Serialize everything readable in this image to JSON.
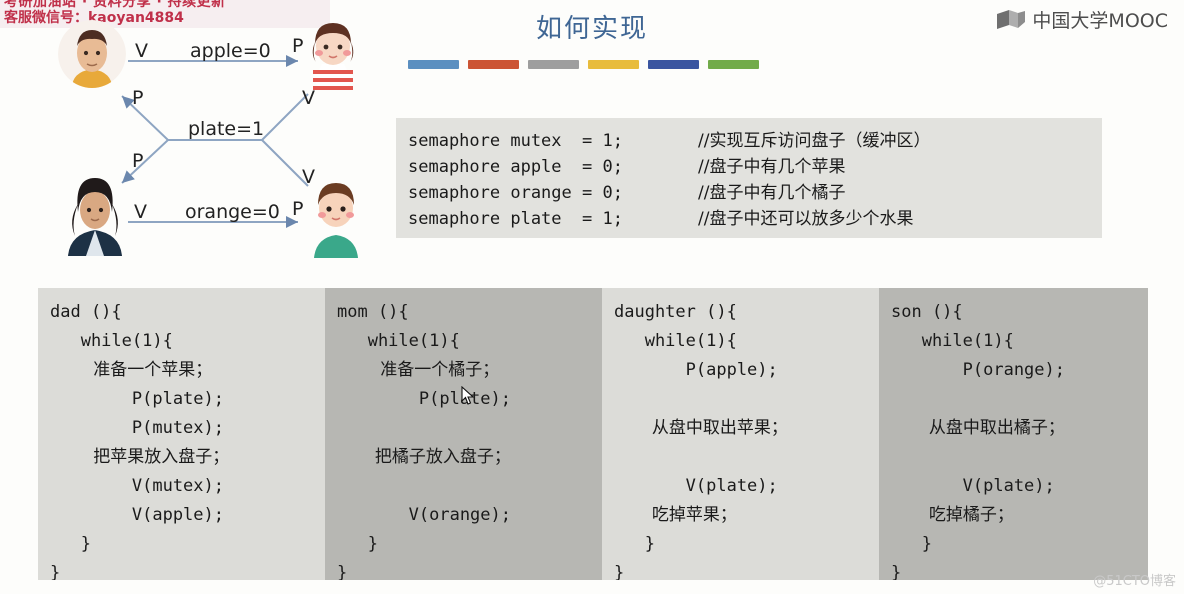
{
  "banner": {
    "line1": "考研加油站 · 资料分享 · 持续更新",
    "line2": "客服微信号：kaoyan4884"
  },
  "brand": {
    "logo_icon": "book-logo-icon",
    "name": "中国大学MOOC"
  },
  "slide": {
    "title": "如何实现",
    "accent_bars": [
      "#5b8fc0",
      "#cc5434",
      "#9e9e9e",
      "#e8bc3c",
      "#3a55a0",
      "#72ab4a"
    ]
  },
  "diagram": {
    "actors": [
      {
        "id": "dad",
        "name": "dad-avatar",
        "role": "父亲"
      },
      {
        "id": "daughter",
        "name": "daughter-avatar",
        "role": "女儿"
      },
      {
        "id": "mom",
        "name": "mom-avatar",
        "role": "母亲"
      },
      {
        "id": "son",
        "name": "son-avatar",
        "role": "儿子"
      }
    ],
    "edges": [
      {
        "id": "apple",
        "label": "apple=0",
        "from_op": "V",
        "to_op": "P"
      },
      {
        "id": "plate",
        "label": "plate=1",
        "from_op": "P",
        "to_op": "V"
      },
      {
        "id": "orange",
        "label": "orange=0",
        "from_op": "V",
        "to_op": "P"
      }
    ],
    "ops": {
      "dad_v": "V",
      "daughter_p": "P",
      "dad_p": "P",
      "daughter_v": "V",
      "mom_p": "P",
      "son_v": "V",
      "mom_v": "V",
      "son_p": "P"
    }
  },
  "semaphores": [
    {
      "code": "semaphore mutex  = 1;",
      "comment": "//实现互斥访问盘子（缓冲区）"
    },
    {
      "code": "semaphore apple  = 0;",
      "comment": "//盘子中有几个苹果"
    },
    {
      "code": "semaphore orange = 0;",
      "comment": "//盘子中有几个橘子"
    },
    {
      "code": "semaphore plate  = 1;",
      "comment": "//盘子中还可以放多少个水果"
    }
  ],
  "processes": [
    {
      "name": "dad",
      "shade": "light",
      "lines": [
        {
          "text": "dad (){",
          "cn": false
        },
        {
          "text": "   while(1){",
          "cn": false
        },
        {
          "text": "        准备一个苹果；",
          "cn": true
        },
        {
          "text": "        P(plate);",
          "cn": false
        },
        {
          "text": "        P(mutex);",
          "cn": false
        },
        {
          "text": "        把苹果放入盘子；",
          "cn": true
        },
        {
          "text": "        V(mutex);",
          "cn": false
        },
        {
          "text": "        V(apple);",
          "cn": false
        },
        {
          "text": "   }",
          "cn": false
        },
        {
          "text": "}",
          "cn": false
        }
      ]
    },
    {
      "name": "mom",
      "shade": "dark",
      "lines": [
        {
          "text": "mom (){",
          "cn": false
        },
        {
          "text": "   while(1){",
          "cn": false
        },
        {
          "text": "        准备一个橘子；",
          "cn": true
        },
        {
          "text": "        P(plate);",
          "cn": false
        },
        {
          "text": "",
          "cn": false
        },
        {
          "text": "       把橘子放入盘子；",
          "cn": true
        },
        {
          "text": "",
          "cn": false
        },
        {
          "text": "       V(orange);",
          "cn": false
        },
        {
          "text": "   }",
          "cn": false
        },
        {
          "text": "}",
          "cn": false
        }
      ]
    },
    {
      "name": "daughter",
      "shade": "light",
      "lines": [
        {
          "text": "daughter (){",
          "cn": false
        },
        {
          "text": "   while(1){",
          "cn": false
        },
        {
          "text": "       P(apple);",
          "cn": false
        },
        {
          "text": "",
          "cn": false
        },
        {
          "text": "       从盘中取出苹果；",
          "cn": true
        },
        {
          "text": "",
          "cn": false
        },
        {
          "text": "       V(plate);",
          "cn": false
        },
        {
          "text": "       吃掉苹果；",
          "cn": true
        },
        {
          "text": "   }",
          "cn": false
        },
        {
          "text": "}",
          "cn": false
        }
      ]
    },
    {
      "name": "son",
      "shade": "dark",
      "lines": [
        {
          "text": "son (){",
          "cn": false
        },
        {
          "text": "   while(1){",
          "cn": false
        },
        {
          "text": "       P(orange);",
          "cn": false
        },
        {
          "text": "",
          "cn": false
        },
        {
          "text": "       从盘中取出橘子；",
          "cn": true
        },
        {
          "text": "",
          "cn": false
        },
        {
          "text": "       V(plate);",
          "cn": false
        },
        {
          "text": "       吃掉橘子；",
          "cn": true
        },
        {
          "text": "   }",
          "cn": false
        },
        {
          "text": "}",
          "cn": false
        }
      ]
    }
  ],
  "watermark": "@51CTO博客"
}
